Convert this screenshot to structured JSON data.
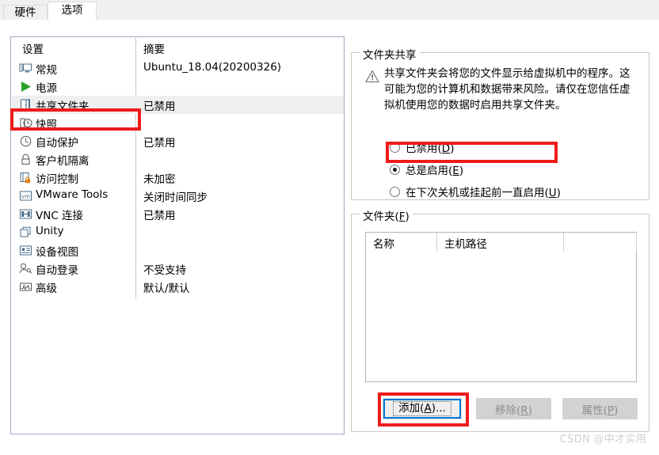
{
  "window": {
    "tabs": [
      {
        "id": "hardware",
        "label": "硬件",
        "active": false
      },
      {
        "id": "options",
        "label": "选项",
        "active": true
      }
    ]
  },
  "settings_list": {
    "headers": {
      "setting": "设置",
      "summary": "摘要"
    },
    "rows": [
      {
        "icon": "monitor-icon",
        "label": "常规",
        "summary": "Ubuntu_18.04(20200326)",
        "selected": false
      },
      {
        "icon": "power-play-icon",
        "label": "电源",
        "summary": "",
        "selected": false
      },
      {
        "icon": "shared-folder-icon",
        "label": "共享文件夹",
        "summary": "已禁用",
        "selected": true
      },
      {
        "icon": "snapshot-clock-icon",
        "label": "快照",
        "summary": "",
        "selected": false
      },
      {
        "icon": "autoprotect-clock-icon",
        "label": "自动保护",
        "summary": "已禁用",
        "selected": false
      },
      {
        "icon": "lock-icon",
        "label": "客户机隔离",
        "summary": "",
        "selected": false
      },
      {
        "icon": "access-control-lock-icon",
        "label": "访问控制",
        "summary": "未加密",
        "selected": false
      },
      {
        "icon": "vmware-tools-icon",
        "label": "VMware Tools",
        "summary": "关闭时间同步",
        "selected": false
      },
      {
        "icon": "vnc-connection-icon",
        "label": "VNC 连接",
        "summary": "已禁用",
        "selected": false
      },
      {
        "icon": "unity-windows-icon",
        "label": "Unity",
        "summary": "",
        "selected": false
      },
      {
        "icon": "device-view-icon",
        "label": "设备视图",
        "summary": "",
        "selected": false
      },
      {
        "icon": "auto-login-user-icon",
        "label": "自动登录",
        "summary": "不受支持",
        "selected": false
      },
      {
        "icon": "advanced-graph-icon",
        "label": "高级",
        "summary": "默认/默认",
        "selected": false
      }
    ]
  },
  "folder_sharing": {
    "group_title": "文件夹共享",
    "warning_icon": "warning-triangle-icon",
    "warning_text": "共享文件夹会将您的文件显示给虚拟机中的程序。这可能为您的计算机和数据带来风险。请仅在您信任虚拟机使用您的数据时启用共享文件夹。",
    "options": [
      {
        "id": "disabled",
        "label": "已禁用(",
        "accel": "D",
        "tail": ")",
        "checked": false
      },
      {
        "id": "always-enabled",
        "label": "总是启用(",
        "accel": "E",
        "tail": ")",
        "checked": true
      },
      {
        "id": "until-shutdown",
        "label": "在下次关机或挂起前一直启用(",
        "accel": "U",
        "tail": ")",
        "checked": false
      }
    ]
  },
  "folders": {
    "group_title_main": "文件夹(",
    "group_title_accel": "F",
    "group_title_tail": ")",
    "columns": [
      "名称",
      "主机路径",
      ""
    ],
    "rows": [],
    "buttons": [
      {
        "id": "add",
        "label": "添加(",
        "accel": "A",
        "tail": ")...",
        "enabled": true,
        "focused": true
      },
      {
        "id": "remove",
        "label": "移除(",
        "accel": "R",
        "tail": ")",
        "enabled": false,
        "focused": false
      },
      {
        "id": "properties",
        "label": "属性(",
        "accel": "P",
        "tail": ")",
        "enabled": false,
        "focused": false
      }
    ]
  },
  "highlights": {
    "color": "#ee1b1b",
    "targets": [
      "shared-folder-row",
      "always-enabled-radio",
      "add-button"
    ]
  },
  "focus_color": "#0078d7",
  "watermark": "CSDN @中才实用"
}
